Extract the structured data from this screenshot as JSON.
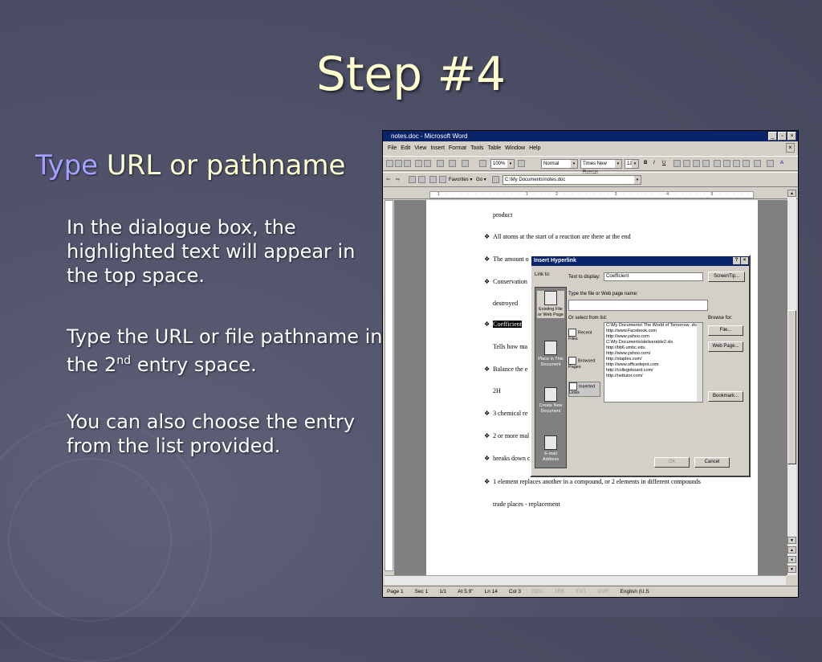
{
  "slide": {
    "title": "Step #4",
    "bullet_keyword": "Type",
    "bullet_rest": "URL or pathname",
    "para1": "In the dialogue box, the highlighted text will appear in the top space.",
    "para2_before": "Type the URL or file pathname in the 2",
    "para2_sup": "nd",
    "para2_after": " entry space.",
    "para3": "You can also choose the entry from the list provided."
  },
  "word": {
    "title": "notes.doc - Microsoft Word",
    "menu": [
      "File",
      "Edit",
      "View",
      "Insert",
      "Format",
      "Tools",
      "Table",
      "Window",
      "Help"
    ],
    "zoom": "100%",
    "style": "Normal",
    "font": "Times New Roman",
    "size": "12",
    "favorites": "Favorites",
    "go": "Go",
    "address": "C:\\My Documents\\notes.doc",
    "doc_lines": {
      "l1": "product",
      "l2": "All atoms at the start of a reaction are there at the end",
      "l3": "The amount o",
      "l4": "Conservation",
      "l5": "destroyed",
      "l6": "Coefficient",
      "l7": "Tells how ma",
      "l8": "Balance the e",
      "l9": "2H",
      "l10": "3 chemical re",
      "l11": "2 or more mal",
      "l12": "breaks down c",
      "l13": "1 element replaces another in a compound, or 2 elements in different compounds",
      "l14": "trade places - replacement"
    },
    "status": {
      "page": "Page 1",
      "sec": "Sec 1",
      "pages": "1/1",
      "at": "At 5.9\"",
      "ln": "Ln 14",
      "col": "Col 3",
      "rec": "REC",
      "trk": "TRK",
      "ext": "EXT",
      "ovr": "OVR",
      "lang": "English (U.S"
    }
  },
  "dialog": {
    "title": "Insert Hyperlink",
    "link_to": "Link to:",
    "text_to_display_label": "Text to display:",
    "text_to_display_value": "Coefficient",
    "screentip": "ScreenTip...",
    "type_label": "Type the file or Web page name:",
    "select_label": "Or select from list:",
    "browse_for": "Browse for:",
    "file_button": "File...",
    "webpage_button": "Web Page...",
    "bookmark_button": "Bookmark...",
    "ok": "OK",
    "cancel": "Cancel",
    "left_items": [
      "Existing File or Web Page",
      "Place in This Document",
      "Create New Document",
      "E-mail Address"
    ],
    "categories": [
      "Recent Files",
      "Browsed Pages",
      "Inserted Links"
    ],
    "list": [
      "C:\\My Documents\\ The World of Tomorrow .doc",
      "http://www.Facebook.com",
      "http://www.yahoo.com",
      "C:\\My Documents\\deliverable2.xls",
      "http://bb6.umbc.edu",
      "http://www.yahoo.com/",
      "http://staples.com/",
      "http://www.officedepot.com",
      "http://collegeboard.com/",
      "http://nettutor.com/"
    ]
  }
}
